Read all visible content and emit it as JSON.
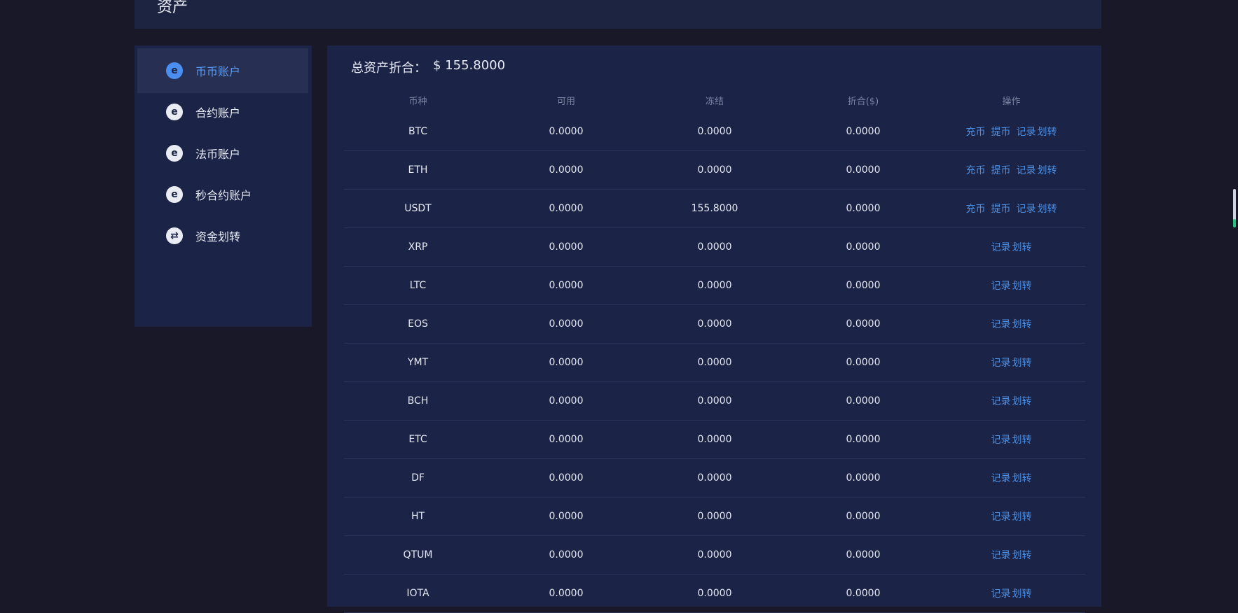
{
  "header": {
    "title": "资产"
  },
  "sidebar": {
    "items": [
      {
        "label": "币币账户",
        "icon": "e-coin-icon",
        "active": true
      },
      {
        "label": "合约账户",
        "icon": "e-coin-icon",
        "active": false
      },
      {
        "label": "法币账户",
        "icon": "e-coin-icon",
        "active": false
      },
      {
        "label": "秒合约账户",
        "icon": "e-coin-icon",
        "active": false
      },
      {
        "label": "资金划转",
        "icon": "transfer-icon",
        "active": false
      }
    ]
  },
  "main": {
    "total_label": "总资产折合：",
    "total_value": "$ 155.8000",
    "table": {
      "headers": [
        "币种",
        "可用",
        "冻结",
        "折合($)",
        "操作"
      ],
      "op_labels": {
        "deposit": "充币",
        "withdraw": "提币",
        "records": "记录",
        "transfer": "划转"
      },
      "rows": [
        {
          "coin": "BTC",
          "available": "0.0000",
          "frozen": "0.0000",
          "converted": "0.0000",
          "full_ops": true
        },
        {
          "coin": "ETH",
          "available": "0.0000",
          "frozen": "0.0000",
          "converted": "0.0000",
          "full_ops": true
        },
        {
          "coin": "USDT",
          "available": "0.0000",
          "frozen": "155.8000",
          "converted": "0.0000",
          "full_ops": true
        },
        {
          "coin": "XRP",
          "available": "0.0000",
          "frozen": "0.0000",
          "converted": "0.0000",
          "full_ops": false
        },
        {
          "coin": "LTC",
          "available": "0.0000",
          "frozen": "0.0000",
          "converted": "0.0000",
          "full_ops": false
        },
        {
          "coin": "EOS",
          "available": "0.0000",
          "frozen": "0.0000",
          "converted": "0.0000",
          "full_ops": false
        },
        {
          "coin": "YMT",
          "available": "0.0000",
          "frozen": "0.0000",
          "converted": "0.0000",
          "full_ops": false
        },
        {
          "coin": "BCH",
          "available": "0.0000",
          "frozen": "0.0000",
          "converted": "0.0000",
          "full_ops": false
        },
        {
          "coin": "ETC",
          "available": "0.0000",
          "frozen": "0.0000",
          "converted": "0.0000",
          "full_ops": false
        },
        {
          "coin": "DF",
          "available": "0.0000",
          "frozen": "0.0000",
          "converted": "0.0000",
          "full_ops": false
        },
        {
          "coin": "HT",
          "available": "0.0000",
          "frozen": "0.0000",
          "converted": "0.0000",
          "full_ops": false
        },
        {
          "coin": "QTUM",
          "available": "0.0000",
          "frozen": "0.0000",
          "converted": "0.0000",
          "full_ops": false
        },
        {
          "coin": "IOTA",
          "available": "0.0000",
          "frozen": "0.0000",
          "converted": "0.0000",
          "full_ops": false
        }
      ]
    }
  },
  "colors": {
    "background": "#181828",
    "panel": "#1b2347",
    "active_item": "#273052",
    "accent": "#4a90e6",
    "muted_text": "#7d85a3"
  }
}
